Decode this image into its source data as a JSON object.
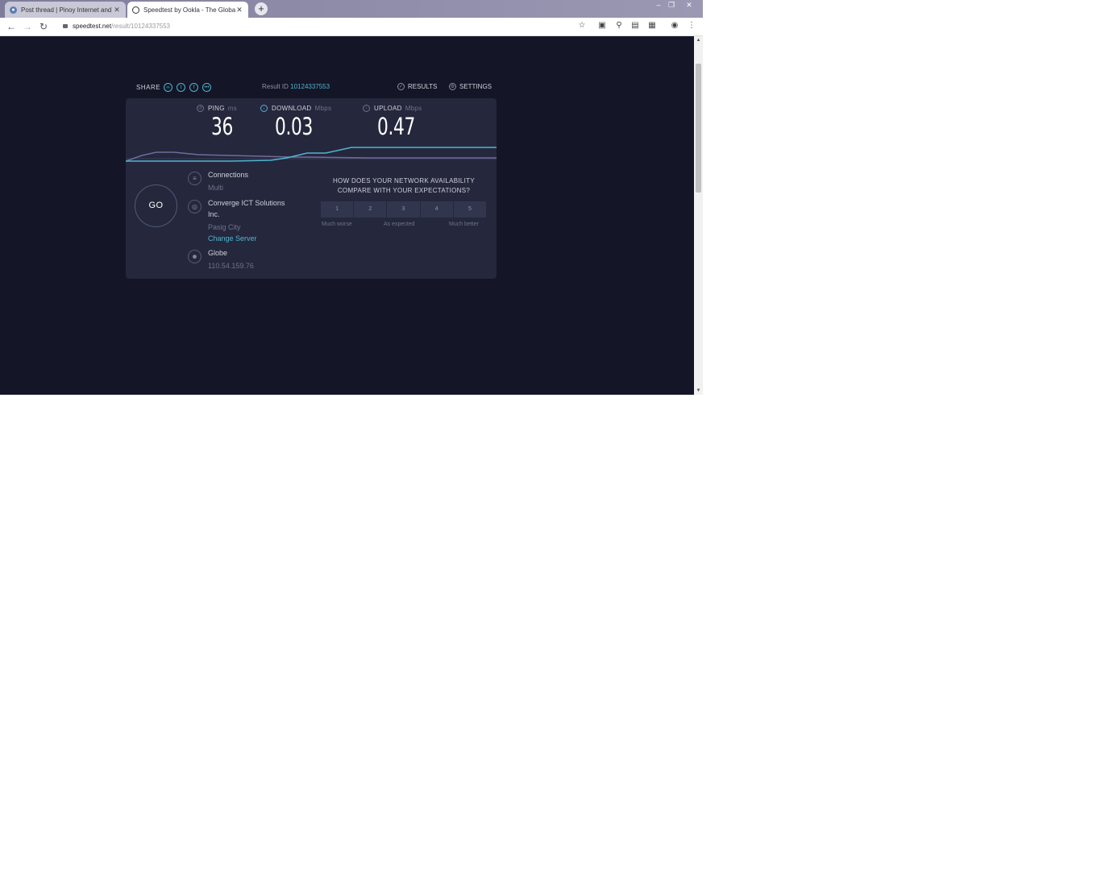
{
  "tabs": [
    {
      "title": "Post thread | Pinoy Internet and",
      "active": false,
      "icon": "forum-favicon-icon"
    },
    {
      "title": "Speedtest by Ookla - The Global",
      "active": true,
      "icon": "speedtest-favicon-icon"
    }
  ],
  "new_tab_symbol": "+",
  "toolbar": {
    "url_host": "speedtest.net",
    "url_path": "/result/10124337553"
  },
  "speedtest": {
    "share_label": "SHARE",
    "result_id_label": "Result ID",
    "result_id": "10124337553",
    "results_label": "RESULTS",
    "settings_label": "SETTINGS",
    "metrics": {
      "ping": {
        "label": "PING",
        "unit": "ms",
        "value": "36"
      },
      "download": {
        "label": "DOWNLOAD",
        "unit": "Mbps",
        "value": "0.03"
      },
      "upload": {
        "label": "UPLOAD",
        "unit": "Mbps",
        "value": "0.47"
      }
    },
    "go_label": "GO",
    "connections": {
      "label": "Connections",
      "value": "Multi"
    },
    "server": {
      "name": "Converge ICT Solutions",
      "name_cont": "Inc.",
      "location": "Pasig City",
      "change_label": "Change Server"
    },
    "isp": {
      "name": "Globe",
      "ip": "110.54.159.76"
    },
    "survey": {
      "question_line1": "HOW DOES YOUR NETWORK AVAILABILITY",
      "question_line2": "COMPARE WITH YOUR EXPECTATIONS?",
      "options": [
        "1",
        "2",
        "3",
        "4",
        "5"
      ],
      "low_label": "Much worse",
      "mid_label": "As expected",
      "high_label": "Much better"
    }
  },
  "colors": {
    "page_bg": "#141526",
    "panel_bg": "#25273c",
    "accent": "#4fb5d0",
    "upload_line": "#6f6c9f"
  }
}
